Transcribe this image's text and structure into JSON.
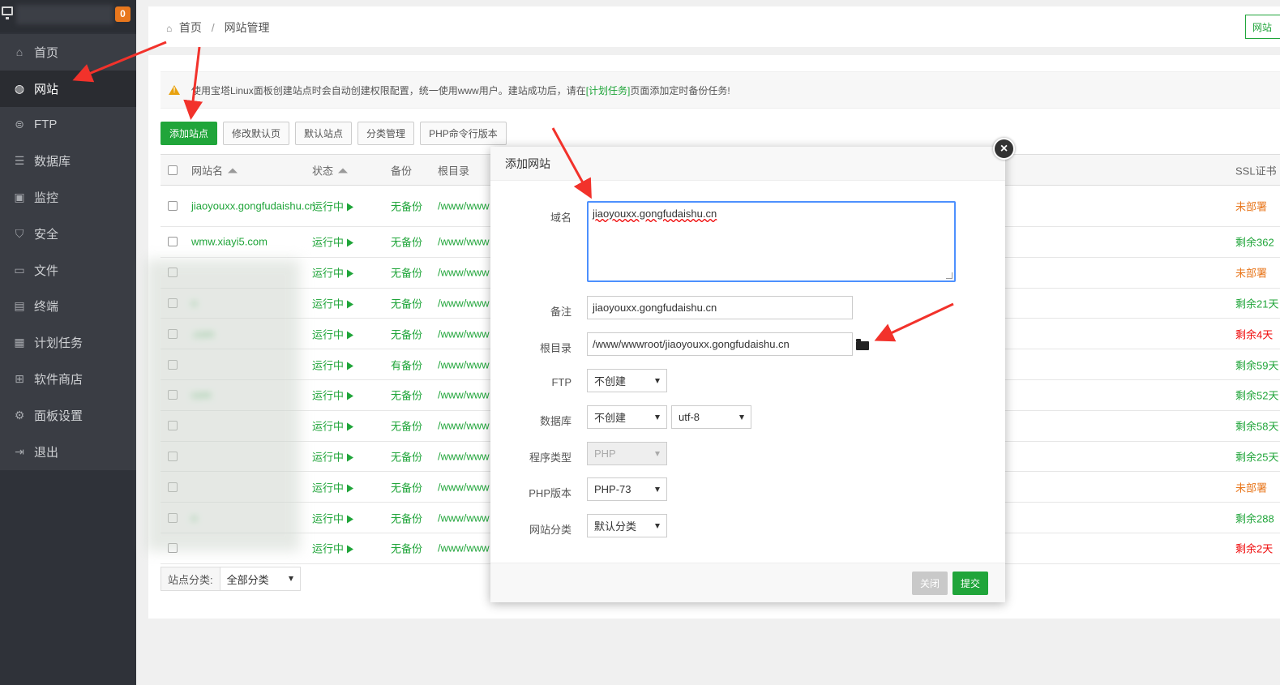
{
  "sidebar": {
    "badge": "0",
    "items": [
      {
        "label": "首页",
        "icon": "home-icon"
      },
      {
        "label": "网站",
        "icon": "globe-icon"
      },
      {
        "label": "FTP",
        "icon": "ftp-icon"
      },
      {
        "label": "数据库",
        "icon": "database-icon"
      },
      {
        "label": "监控",
        "icon": "monitor-icon"
      },
      {
        "label": "安全",
        "icon": "shield-icon"
      },
      {
        "label": "文件",
        "icon": "folder-icon"
      },
      {
        "label": "终端",
        "icon": "terminal-icon"
      },
      {
        "label": "计划任务",
        "icon": "calendar-icon"
      },
      {
        "label": "软件商店",
        "icon": "grid-icon"
      },
      {
        "label": "面板设置",
        "icon": "gear-icon"
      },
      {
        "label": "退出",
        "icon": "logout-icon"
      }
    ]
  },
  "breadcrumb": {
    "home": "首页",
    "separator": "/",
    "current": "网站管理"
  },
  "topbar": {
    "right_button": "网站"
  },
  "notice": {
    "part1": "使用宝塔Linux面板创建站点时会自动创建权限配置，统一使用www用户。建站成功后，请在",
    "link": "[计划任务]",
    "part2": "页面添加定时备份任务!"
  },
  "toolbar": {
    "add_site": "添加站点",
    "modify_default": "修改默认页",
    "default_site": "默认站点",
    "category_manage": "分类管理",
    "php_cli": "PHP命令行版本"
  },
  "table": {
    "headers": {
      "name": "网站名",
      "status": "状态",
      "backup": "备份",
      "root": "根目录",
      "ssl": "SSL证书"
    },
    "rows": [
      {
        "name": "jiaoyouxx.gongfudaishu.cn",
        "status": "运行中",
        "backup": "无备份",
        "root": "/www/www",
        "ssl": "未部署",
        "ssl_color": "#e8771d"
      },
      {
        "name": "wmw.xiayi5.com",
        "status": "运行中",
        "backup": "无备份",
        "root": "/www/www",
        "ssl": "剩余362",
        "ssl_color": "#20a53a"
      },
      {
        "name": "",
        "status": "运行中",
        "backup": "无备份",
        "root": "/www/www",
        "ssl": "未部署",
        "ssl_color": "#e8771d"
      },
      {
        "name": "n",
        "status": "运行中",
        "backup": "无备份",
        "root": "/www/www",
        "ssl": "剩余21天",
        "ssl_color": "#20a53a"
      },
      {
        "name": ".com",
        "status": "运行中",
        "backup": "无备份",
        "root": "/www/www",
        "ssl": "剩余4天",
        "ssl_color": "#ef0808"
      },
      {
        "name": "",
        "status": "运行中",
        "backup": "有备份",
        "root": "/www/www",
        "ssl": "剩余59天",
        "ssl_color": "#20a53a"
      },
      {
        "name": "com",
        "status": "运行中",
        "backup": "无备份",
        "root": "/www/www",
        "ssl": "剩余52天",
        "ssl_color": "#20a53a"
      },
      {
        "name": "",
        "status": "运行中",
        "backup": "无备份",
        "root": "/www/www",
        "ssl": "剩余58天",
        "ssl_color": "#20a53a"
      },
      {
        "name": "",
        "status": "运行中",
        "backup": "无备份",
        "root": "/www/www",
        "ssl": "剩余25天",
        "ssl_color": "#20a53a"
      },
      {
        "name": "",
        "status": "运行中",
        "backup": "无备份",
        "root": "/www/www",
        "ssl": "未部署",
        "ssl_color": "#e8771d"
      },
      {
        "name": "n",
        "status": "运行中",
        "backup": "无备份",
        "root": "/www/www",
        "ssl": "剩余288",
        "ssl_color": "#20a53a"
      },
      {
        "name": "",
        "status": "运行中",
        "backup": "无备份",
        "root": "/www/www",
        "ssl": "剩余2天",
        "ssl_color": "#ef0808"
      }
    ]
  },
  "filter": {
    "label": "站点分类:",
    "value": "全部分类"
  },
  "dialog": {
    "title": "添加网站",
    "close_icon": "×",
    "domain_label": "域名",
    "domain_value": "jiaoyouxx.gongfudaishu.cn",
    "remark_label": "备注",
    "remark_value": "jiaoyouxx.gongfudaishu.cn",
    "root_label": "根目录",
    "root_value": "/www/wwwroot/jiaoyouxx.gongfudaishu.cn",
    "ftp_label": "FTP",
    "ftp_value": "不创建",
    "db_label": "数据库",
    "db_value": "不创建",
    "db_charset": "utf-8",
    "program_label": "程序类型",
    "program_value": "PHP",
    "php_label": "PHP版本",
    "php_value": "PHP-73",
    "category_label": "网站分类",
    "category_value": "默认分类",
    "close_button": "关闭",
    "submit_button": "提交"
  },
  "colors": {
    "accent": "#20a53a",
    "sidebar_bg": "#3a3d44",
    "warning": "#e8771d",
    "danger": "#ef0808",
    "annotation": "#f2322b"
  }
}
